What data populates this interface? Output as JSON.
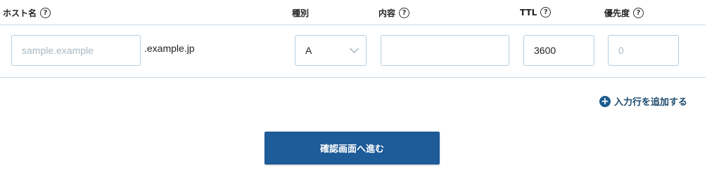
{
  "headers": {
    "host": "ホスト名",
    "type": "種別",
    "content": "内容",
    "ttl": "TTL",
    "priority": "優先度",
    "help_glyph": "?"
  },
  "row": {
    "host_placeholder": "sample.example",
    "host_value": "",
    "domain_suffix": ".example.jp",
    "type_value": "A",
    "content_value": "",
    "ttl_value": "3600",
    "priority_placeholder": "0",
    "priority_value": ""
  },
  "actions": {
    "add_row_label": "入力行を追加する",
    "add_icon": "+",
    "submit_label": "確認画面へ進む"
  },
  "colors": {
    "accent": "#1d5b99",
    "border": "#b7cddd"
  }
}
